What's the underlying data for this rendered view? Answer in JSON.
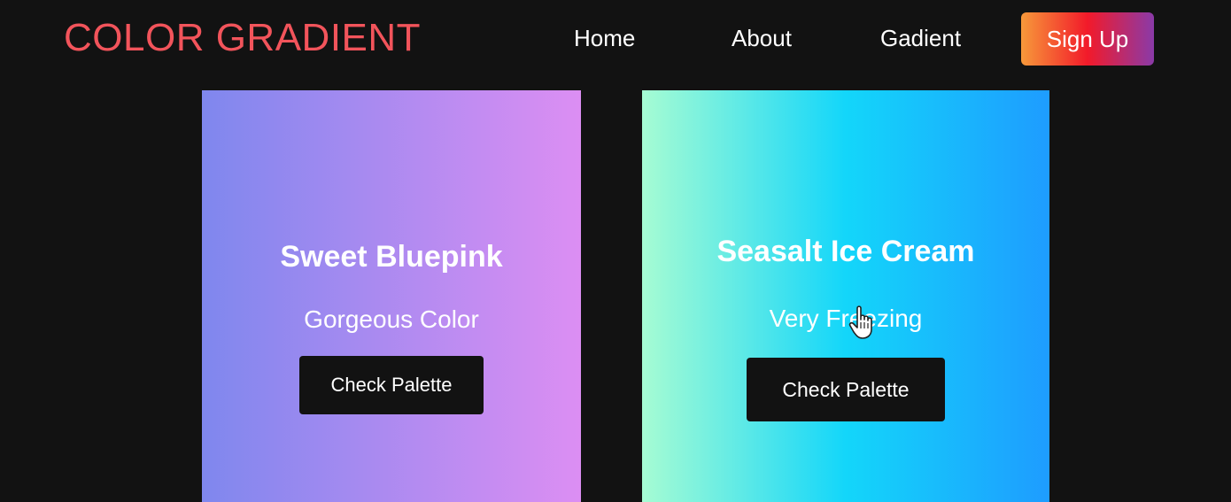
{
  "header": {
    "logo": "COLOR GRADIENT",
    "logo_color": "#f2545b",
    "nav": [
      {
        "label": "Home"
      },
      {
        "label": "About"
      },
      {
        "label": "Gadient"
      }
    ],
    "signup_label": "Sign Up",
    "signup_gradient": [
      "#f7993a",
      "#f21a2a",
      "#8a3aa8"
    ]
  },
  "cards": [
    {
      "title": "Sweet Bluepink",
      "subtitle": "Gorgeous Color",
      "button_label": "Check Palette",
      "gradient": [
        "#7f87ee",
        "#dc8ef3"
      ]
    },
    {
      "title": "Seasalt Ice Cream",
      "subtitle": "Very Freezing",
      "button_label": "Check Palette",
      "gradient": [
        "#a6fcd3",
        "#13d6fa",
        "#1e9cff"
      ]
    }
  ],
  "cursor_icon": "hand-pointer-icon"
}
